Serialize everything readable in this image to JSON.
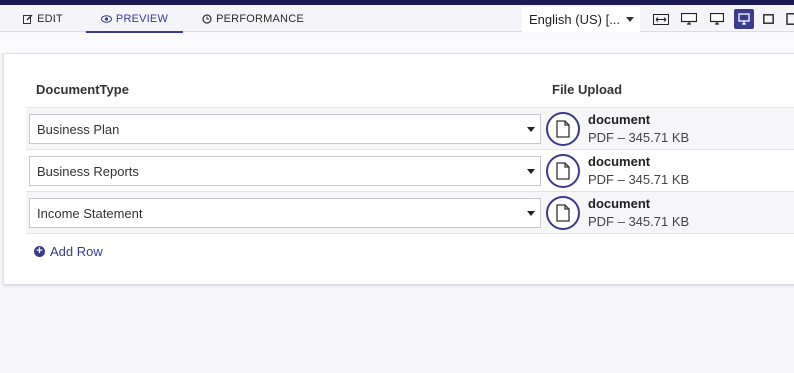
{
  "toolbar": {
    "tabs": [
      {
        "label": "EDIT",
        "icon": "edit-icon"
      },
      {
        "label": "PREVIEW",
        "icon": "eye-icon",
        "active": true
      },
      {
        "label": "PERFORMANCE",
        "icon": "clock-icon"
      }
    ],
    "language": "English (US) [...",
    "devices": [
      "fit-width-icon",
      "desktop-large-icon",
      "desktop-icon",
      "monitor-icon",
      "tablet-landscape-icon",
      "tablet-portrait-icon"
    ],
    "selected_device": "monitor-icon"
  },
  "table": {
    "headers": {
      "document_type": "DocumentType",
      "file_upload": "File Upload"
    },
    "rows": [
      {
        "document_type": "Business Plan",
        "file_name": "document",
        "file_meta": "PDF – 345.71 KB"
      },
      {
        "document_type": "Business Reports",
        "file_name": "document",
        "file_meta": "PDF – 345.71 KB"
      },
      {
        "document_type": "Income Statement",
        "file_name": "document",
        "file_meta": "PDF – 345.71 KB"
      }
    ],
    "add_row_label": "Add Row"
  },
  "colors": {
    "accent": "#3b3b8e",
    "top_stripe": "#1c1c52",
    "toolbar_bg": "#f4f4f9"
  }
}
